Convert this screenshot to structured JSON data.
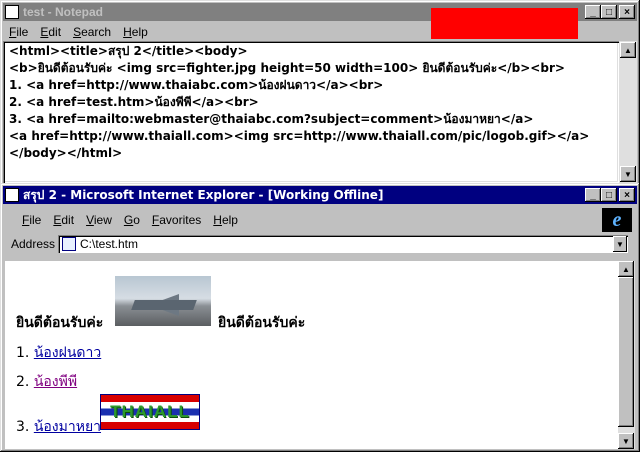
{
  "notepad": {
    "title": "test - Notepad",
    "menu": [
      "File",
      "Edit",
      "Search",
      "Help"
    ],
    "lines": [
      "<html><title>สรุป 2</title><body>",
      "<b>ยินดีต้อนรับค่ะ <img src=fighter.jpg height=50 width=100> ยินดีต้อนรับค่ะ</b><br>",
      "1. <a href=http://www.thaiabc.com>น้องฝนดาว</a><br>",
      "2. <a href=test.htm>น้องพีพี</a><br>",
      "3. <a href=mailto:webmaster@thaiabc.com?subject=comment>น้องมาหยา</a>",
      "<a href=http://www.thaiall.com><img src=http://www.thaiall.com/pic/logob.gif></a>",
      "</body></html>"
    ]
  },
  "browser": {
    "title": "สรุป 2 - Microsoft Internet Explorer - [Working Offline]",
    "menu": [
      "File",
      "Edit",
      "View",
      "Go",
      "Favorites",
      "Help"
    ],
    "address_label": "Address",
    "address_value": "C:\\test.htm",
    "logo_letter": "e"
  },
  "page": {
    "welcome_left": "ยินดีต้อนรับค่ะ",
    "welcome_right": "ยินดีต้อนรับค่ะ",
    "items": [
      {
        "num": "1.",
        "label": "น้องฝนดาว"
      },
      {
        "num": "2.",
        "label": "น้องพีพี"
      },
      {
        "num": "3.",
        "label": "น้องมาหยา"
      }
    ],
    "banner_text": "THAIALL"
  },
  "window_buttons": {
    "minimize": "_",
    "maximize": "□",
    "close": "×"
  },
  "colors": {
    "title_active": "#000080",
    "title_inactive": "#808080",
    "link": "#0000a0",
    "visited": "#800080"
  }
}
